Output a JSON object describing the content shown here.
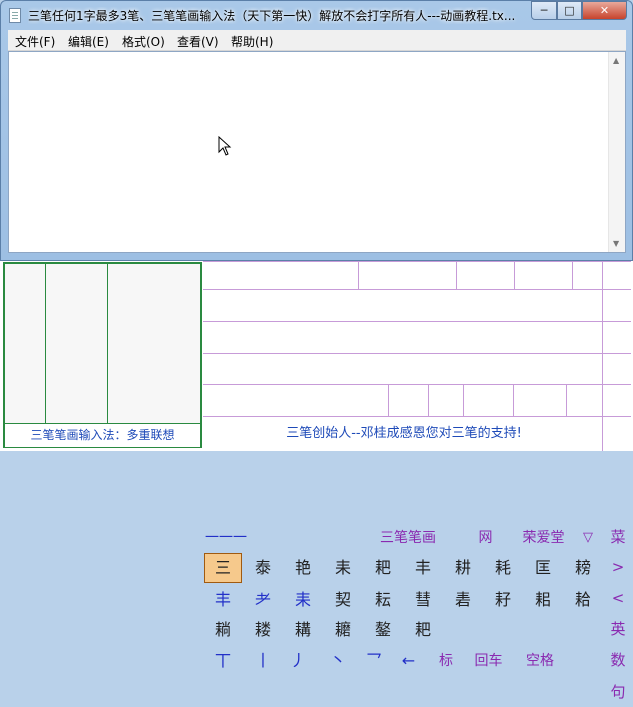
{
  "window": {
    "title": "三笔任何1字最多3笔、三笔笔画输入法（天下第一快）解放不会打字所有人---动画教程.tx...",
    "min_label": "─",
    "max_label": "□",
    "close_label": "✕"
  },
  "menu": [
    "文件(F)",
    "编辑(E)",
    "格式(O)",
    "查看(V)",
    "帮助(H)"
  ],
  "ime": {
    "left_status": "三笔笔画输入法：多重联想",
    "stroke_display": "一一一",
    "header_buttons": [
      "三笔笔画",
      "网",
      "荣爱堂",
      "▽"
    ],
    "row1": [
      "三",
      "泰",
      "艳",
      "耒",
      "耙",
      "丰",
      "耕",
      "耗",
      "匡",
      "耪"
    ],
    "row2": [
      "丰",
      "耂",
      "耒",
      "契",
      "耘",
      "彗",
      "砉",
      "耔",
      "耜",
      "耠"
    ],
    "row3": [
      "耥",
      "耧",
      "耩",
      "耱",
      "鏊",
      "耙"
    ],
    "stroke_keys": [
      "丅",
      "丨",
      "丿",
      "丶",
      "乛",
      "←",
      "标",
      "回车",
      "空格"
    ],
    "side_buttons": [
      "菜",
      ">",
      "<",
      "英",
      "数",
      "句"
    ],
    "footer": "三笔创始人--邓桂成感恩您对三笔的支持!"
  }
}
